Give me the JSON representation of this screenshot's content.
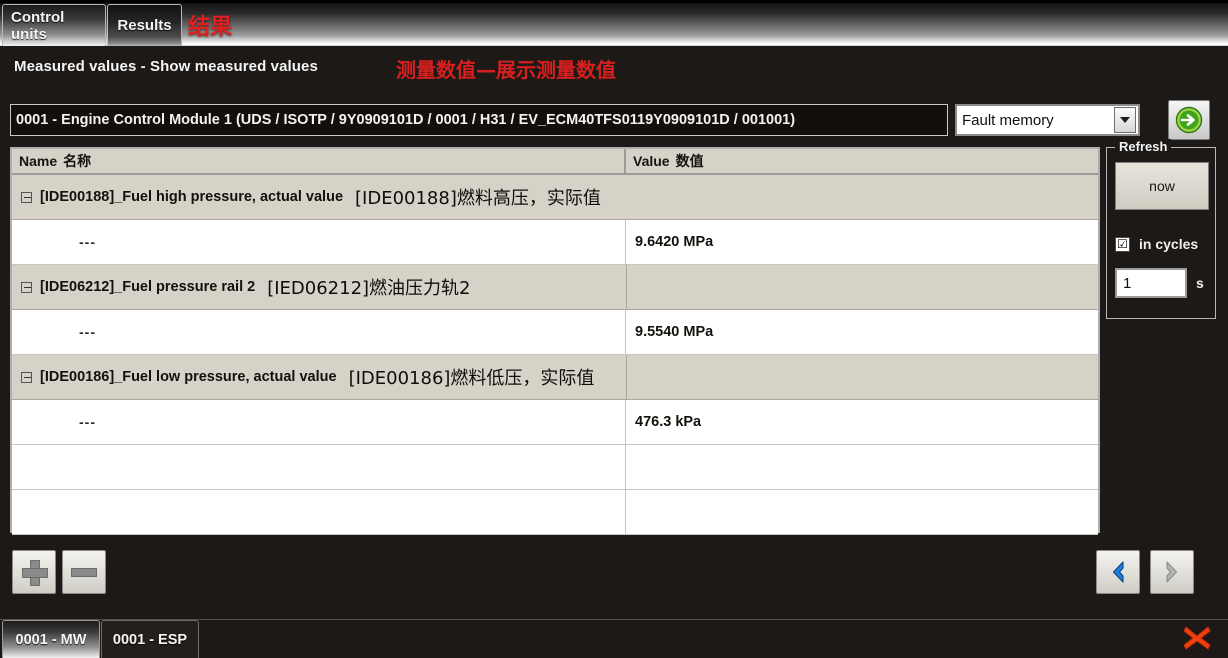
{
  "tabs": {
    "control_units": "Control units",
    "results": "Results",
    "results_cn": "结果"
  },
  "title": {
    "english": "Measured values - Show measured values",
    "chinese": "测量数值—展示测量数值",
    "accent_color": "#d81f1f"
  },
  "ecu": {
    "text": "0001 - Engine Control Module 1  (UDS / ISOTP / 9Y0909101D / 0001 / H31 / EV_ECM40TFS0119Y0909101D / 001001)"
  },
  "mode_select": {
    "value": "Fault memory",
    "arrow_icon": "chevron-down-icon"
  },
  "go_button": {
    "icon": "green-arrow-right-icon",
    "color": "#2a9b2a"
  },
  "table": {
    "headers": {
      "name_en": "Name",
      "name_cn": "名称",
      "value_en": "Value",
      "value_cn": "数值"
    },
    "rows": [
      {
        "kind": "group",
        "spill": true,
        "en": "[IDE00188]_Fuel high pressure, actual value",
        "cn": "[IDE00188]燃料高压，实际值",
        "value": ""
      },
      {
        "kind": "data",
        "spill": false,
        "en": "---",
        "cn": "",
        "value": "9.6420 MPa"
      },
      {
        "kind": "group",
        "spill": false,
        "en": "[IDE06212]_Fuel pressure rail 2",
        "cn": "[IED06212]燃油压力轨2",
        "value": ""
      },
      {
        "kind": "data",
        "spill": false,
        "en": "---",
        "cn": "",
        "value": "9.5540 MPa"
      },
      {
        "kind": "group",
        "spill": false,
        "en": "[IDE00186]_Fuel low pressure, actual value",
        "cn": "[IDE00186]燃料低压，实际值",
        "value": ""
      },
      {
        "kind": "data",
        "spill": false,
        "en": "---",
        "cn": "",
        "value": "476.3 kPa"
      },
      {
        "kind": "blank",
        "spill": false,
        "en": "",
        "cn": "",
        "value": ""
      },
      {
        "kind": "blank",
        "spill": false,
        "en": "",
        "cn": "",
        "value": ""
      }
    ]
  },
  "refresh": {
    "legend": "Refresh",
    "now_label": "now",
    "in_cycles_label": "in cycles",
    "in_cycles_checked": "☑",
    "interval_value": "1",
    "interval_unit": "s"
  },
  "toolbar": {
    "add_label": "+",
    "remove_label": "−",
    "prev_icon": "chevron-left-icon",
    "next_icon": "chevron-right-icon"
  },
  "bottom_tabs": {
    "mw": "0001 - MW",
    "esp": "0001 - ESP"
  },
  "close": {
    "icon": "red-x-icon",
    "color": "#f04010"
  }
}
